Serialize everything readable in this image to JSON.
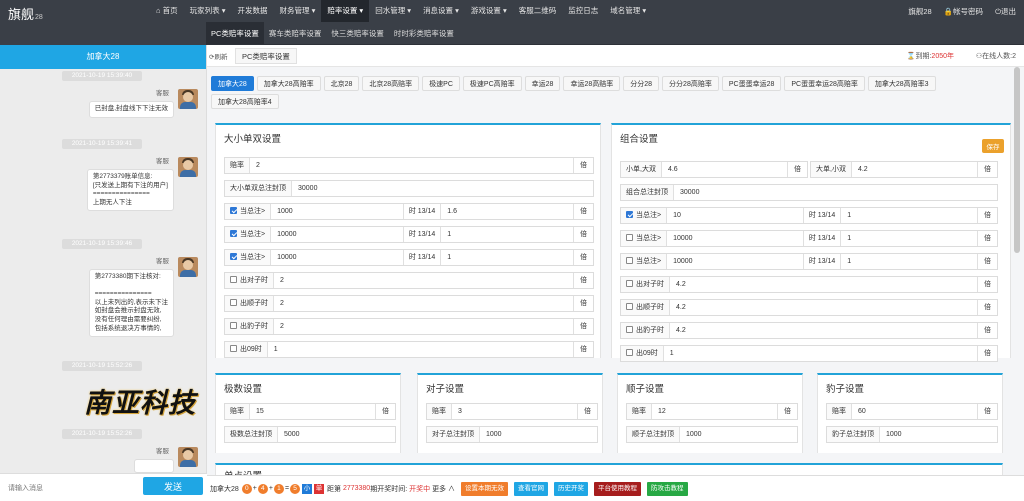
{
  "app": {
    "logo": "旗舰",
    "logo_suffix": "28"
  },
  "menu": [
    {
      "label": "⌂ 首页"
    },
    {
      "label": "玩家列表 ▾"
    },
    {
      "label": "开发数据"
    },
    {
      "label": "财务管理 ▾"
    },
    {
      "label": "赔率设置 ▾"
    },
    {
      "label": "回水管理 ▾"
    },
    {
      "label": "消息设置 ▾"
    },
    {
      "label": "游戏设置 ▾"
    },
    {
      "label": "客服二维码"
    },
    {
      "label": "监控日志"
    },
    {
      "label": "域名管理 ▾"
    }
  ],
  "topright": {
    "user": "旗舰28",
    "pwd": "帐号密码",
    "logout": "退出"
  },
  "subnav": [
    "PC类赔率设置",
    "赛车类赔率设置",
    "快三类赔率设置",
    "时时彩类赔率设置"
  ],
  "chat": {
    "title": "加拿大28",
    "input_placeholder": "请输入消息",
    "send": "发送",
    "watermark": "南亚科技",
    "messages": [
      {
        "ts": "2021-10-19 15:39:40",
        "nick": "客服",
        "text": "已封盘,封盘线下下注无效"
      },
      {
        "ts": "2021-10-19 15:39:41",
        "nick": "客服",
        "text": "第2773379账单信息:\n[只发送上期有下注的用户]\n===============\n上期无人下注"
      },
      {
        "ts": "2021-10-19 15:39:46",
        "nick": "客服",
        "text": "第2773380期下注核对:\n\n===============\n以上未列出的,表示未下注\n如封盘会推示封盘无效,\n没有任何理由需要纠纷,\n包括系统退决方事情的,"
      },
      {
        "ts": "2021-10-19 15:52:26",
        "nick": "",
        "text": ""
      },
      {
        "ts": "2021-10-19 15:52:26",
        "nick": "客服",
        "text": ""
      }
    ]
  },
  "mainbar": {
    "refresh": "⟳刷新",
    "page_tab": "PC类赔率设置",
    "expire_label": "到期:",
    "expire_value": "2050年",
    "online": "在线人数:2"
  },
  "tabs": [
    "加拿大28",
    "加拿大28高赔率",
    "北京28",
    "北京28高赔率",
    "极速PC",
    "极速PC高赔率",
    "幸运28",
    "幸运28高赔率",
    "分分28",
    "分分28高赔率",
    "PC蛋蛋幸运28",
    "PC蛋蛋幸运28高赔率",
    "加拿大28高赔率3",
    "加拿大28高赔率4"
  ],
  "dxds": {
    "title": "大小单双设置",
    "odds_label": "赔率",
    "odds": "2",
    "unit": "倍",
    "cap_label": "大小单双总注封顶",
    "cap": "30000",
    "rows": [
      {
        "checked": true,
        "label": "当总注>",
        "value": "1000",
        "mid": "时 13/14",
        "odds": "1.6"
      },
      {
        "checked": true,
        "label": "当总注>",
        "value": "10000",
        "mid": "时 13/14",
        "odds": "1"
      },
      {
        "checked": true,
        "label": "当总注>",
        "value": "10000",
        "mid": "时 13/14",
        "odds": "1"
      },
      {
        "checked": false,
        "label": "出对子时",
        "value": "2"
      },
      {
        "checked": false,
        "label": "出顺子时",
        "value": "2"
      },
      {
        "checked": false,
        "label": "出豹子时",
        "value": "2"
      },
      {
        "checked": false,
        "label": "出09时",
        "value": "1"
      }
    ]
  },
  "combo": {
    "title": "组合设置",
    "save": "保存",
    "r1": {
      "lab1": "小单,大双",
      "v1": "4.6",
      "lab2": "大单,小双",
      "v2": "4.2"
    },
    "cap_label": "组合总注封顶",
    "cap": "30000",
    "rows": [
      {
        "checked": true,
        "label": "当总注>",
        "value": "10",
        "mid": "时 13/14",
        "odds": "1"
      },
      {
        "checked": false,
        "label": "当总注>",
        "value": "10000",
        "mid": "时 13/14",
        "odds": "1"
      },
      {
        "checked": false,
        "label": "当总注>",
        "value": "10000",
        "mid": "时 13/14",
        "odds": "1"
      },
      {
        "checked": false,
        "label": "出对子时",
        "value": "4.2"
      },
      {
        "checked": false,
        "label": "出顺子时",
        "value": "4.2"
      },
      {
        "checked": false,
        "label": "出豹子时",
        "value": "4.2"
      },
      {
        "checked": false,
        "label": "出09时",
        "value": "1"
      }
    ]
  },
  "extreme": {
    "title": "极数设置",
    "odds": "15",
    "cap_label": "极数总注封顶",
    "cap": "5000"
  },
  "pair": {
    "title": "对子设置",
    "odds": "3",
    "cap_label": "对子总注封顶",
    "cap": "1000"
  },
  "straight": {
    "title": "顺子设置",
    "odds": "12",
    "cap_label": "顺子总注封顶",
    "cap": "1000"
  },
  "leopard": {
    "title": "豹子设置",
    "odds": "60",
    "cap_label": "豹子总注封顶",
    "cap": "1000"
  },
  "single": {
    "title": "单点设置"
  },
  "bottom": {
    "game": "加拿大28",
    "balls": [
      "0",
      "4",
      "1",
      "5"
    ],
    "ops": [
      "+",
      "+",
      "="
    ],
    "tag_small": "小",
    "tag_single": "单",
    "dist_label": "距第",
    "issue": "2773380",
    "dist_suffix": "期开奖时间:",
    "status": "开奖中",
    "more": "更多 ∧",
    "buttons": [
      {
        "label": "设置本期无效",
        "color": "#f07d2c"
      },
      {
        "label": "查看官网",
        "color": "#1fa6e4"
      },
      {
        "label": "历史开奖",
        "color": "#1fa6e4"
      },
      {
        "label": "平台使用教程",
        "color": "#a61d1d"
      },
      {
        "label": "防攻击教程",
        "color": "#27a844"
      }
    ]
  }
}
